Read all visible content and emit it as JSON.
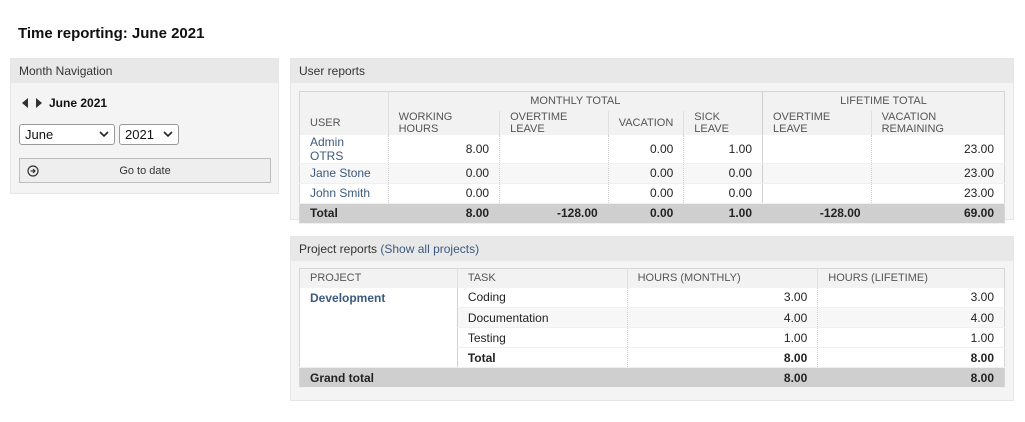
{
  "page": {
    "title": "Time reporting: June 2021"
  },
  "sidebar": {
    "header": "Month Navigation",
    "current_month": "June 2021",
    "month_select": "June",
    "year_select": "2021",
    "goto_label": "Go to date"
  },
  "user_reports": {
    "header": "User reports",
    "group_monthly": "Monthly total",
    "group_lifetime": "Lifetime total",
    "columns": [
      "User",
      "Working hours",
      "Overtime leave",
      "Vacation",
      "Sick leave",
      "Overtime leave",
      "Vacation remaining"
    ],
    "rows": [
      {
        "user": "Admin OTRS",
        "working": "8.00",
        "overtime": "",
        "vacation": "0.00",
        "sick": "1.00",
        "lt_overtime": "",
        "vac_remaining": "23.00"
      },
      {
        "user": "Jane Stone",
        "working": "0.00",
        "overtime": "",
        "vacation": "0.00",
        "sick": "0.00",
        "lt_overtime": "",
        "vac_remaining": "23.00"
      },
      {
        "user": "John Smith",
        "working": "0.00",
        "overtime": "",
        "vacation": "0.00",
        "sick": "0.00",
        "lt_overtime": "",
        "vac_remaining": "23.00"
      }
    ],
    "total": {
      "label": "Total",
      "working": "8.00",
      "overtime": "-128.00",
      "vacation": "0.00",
      "sick": "1.00",
      "lt_overtime": "-128.00",
      "vac_remaining": "69.00"
    }
  },
  "project_reports": {
    "header": "Project reports",
    "show_all": "(Show all projects)",
    "columns": [
      "Project",
      "Task",
      "Hours (monthly)",
      "Hours (lifetime)"
    ],
    "project": "Development",
    "tasks": [
      {
        "task": "Coding",
        "monthly": "3.00",
        "lifetime": "3.00"
      },
      {
        "task": "Documentation",
        "monthly": "4.00",
        "lifetime": "4.00"
      },
      {
        "task": "Testing",
        "monthly": "1.00",
        "lifetime": "1.00"
      }
    ],
    "subtotal": {
      "label": "Total",
      "monthly": "8.00",
      "lifetime": "8.00"
    },
    "grand_total": {
      "label": "Grand total",
      "monthly": "8.00",
      "lifetime": "8.00"
    }
  },
  "icons": {
    "prev": "triangle-left-icon",
    "next": "triangle-right-icon",
    "goto": "circle-arrow-right-icon",
    "dropdown": "chevron-down-icon"
  }
}
